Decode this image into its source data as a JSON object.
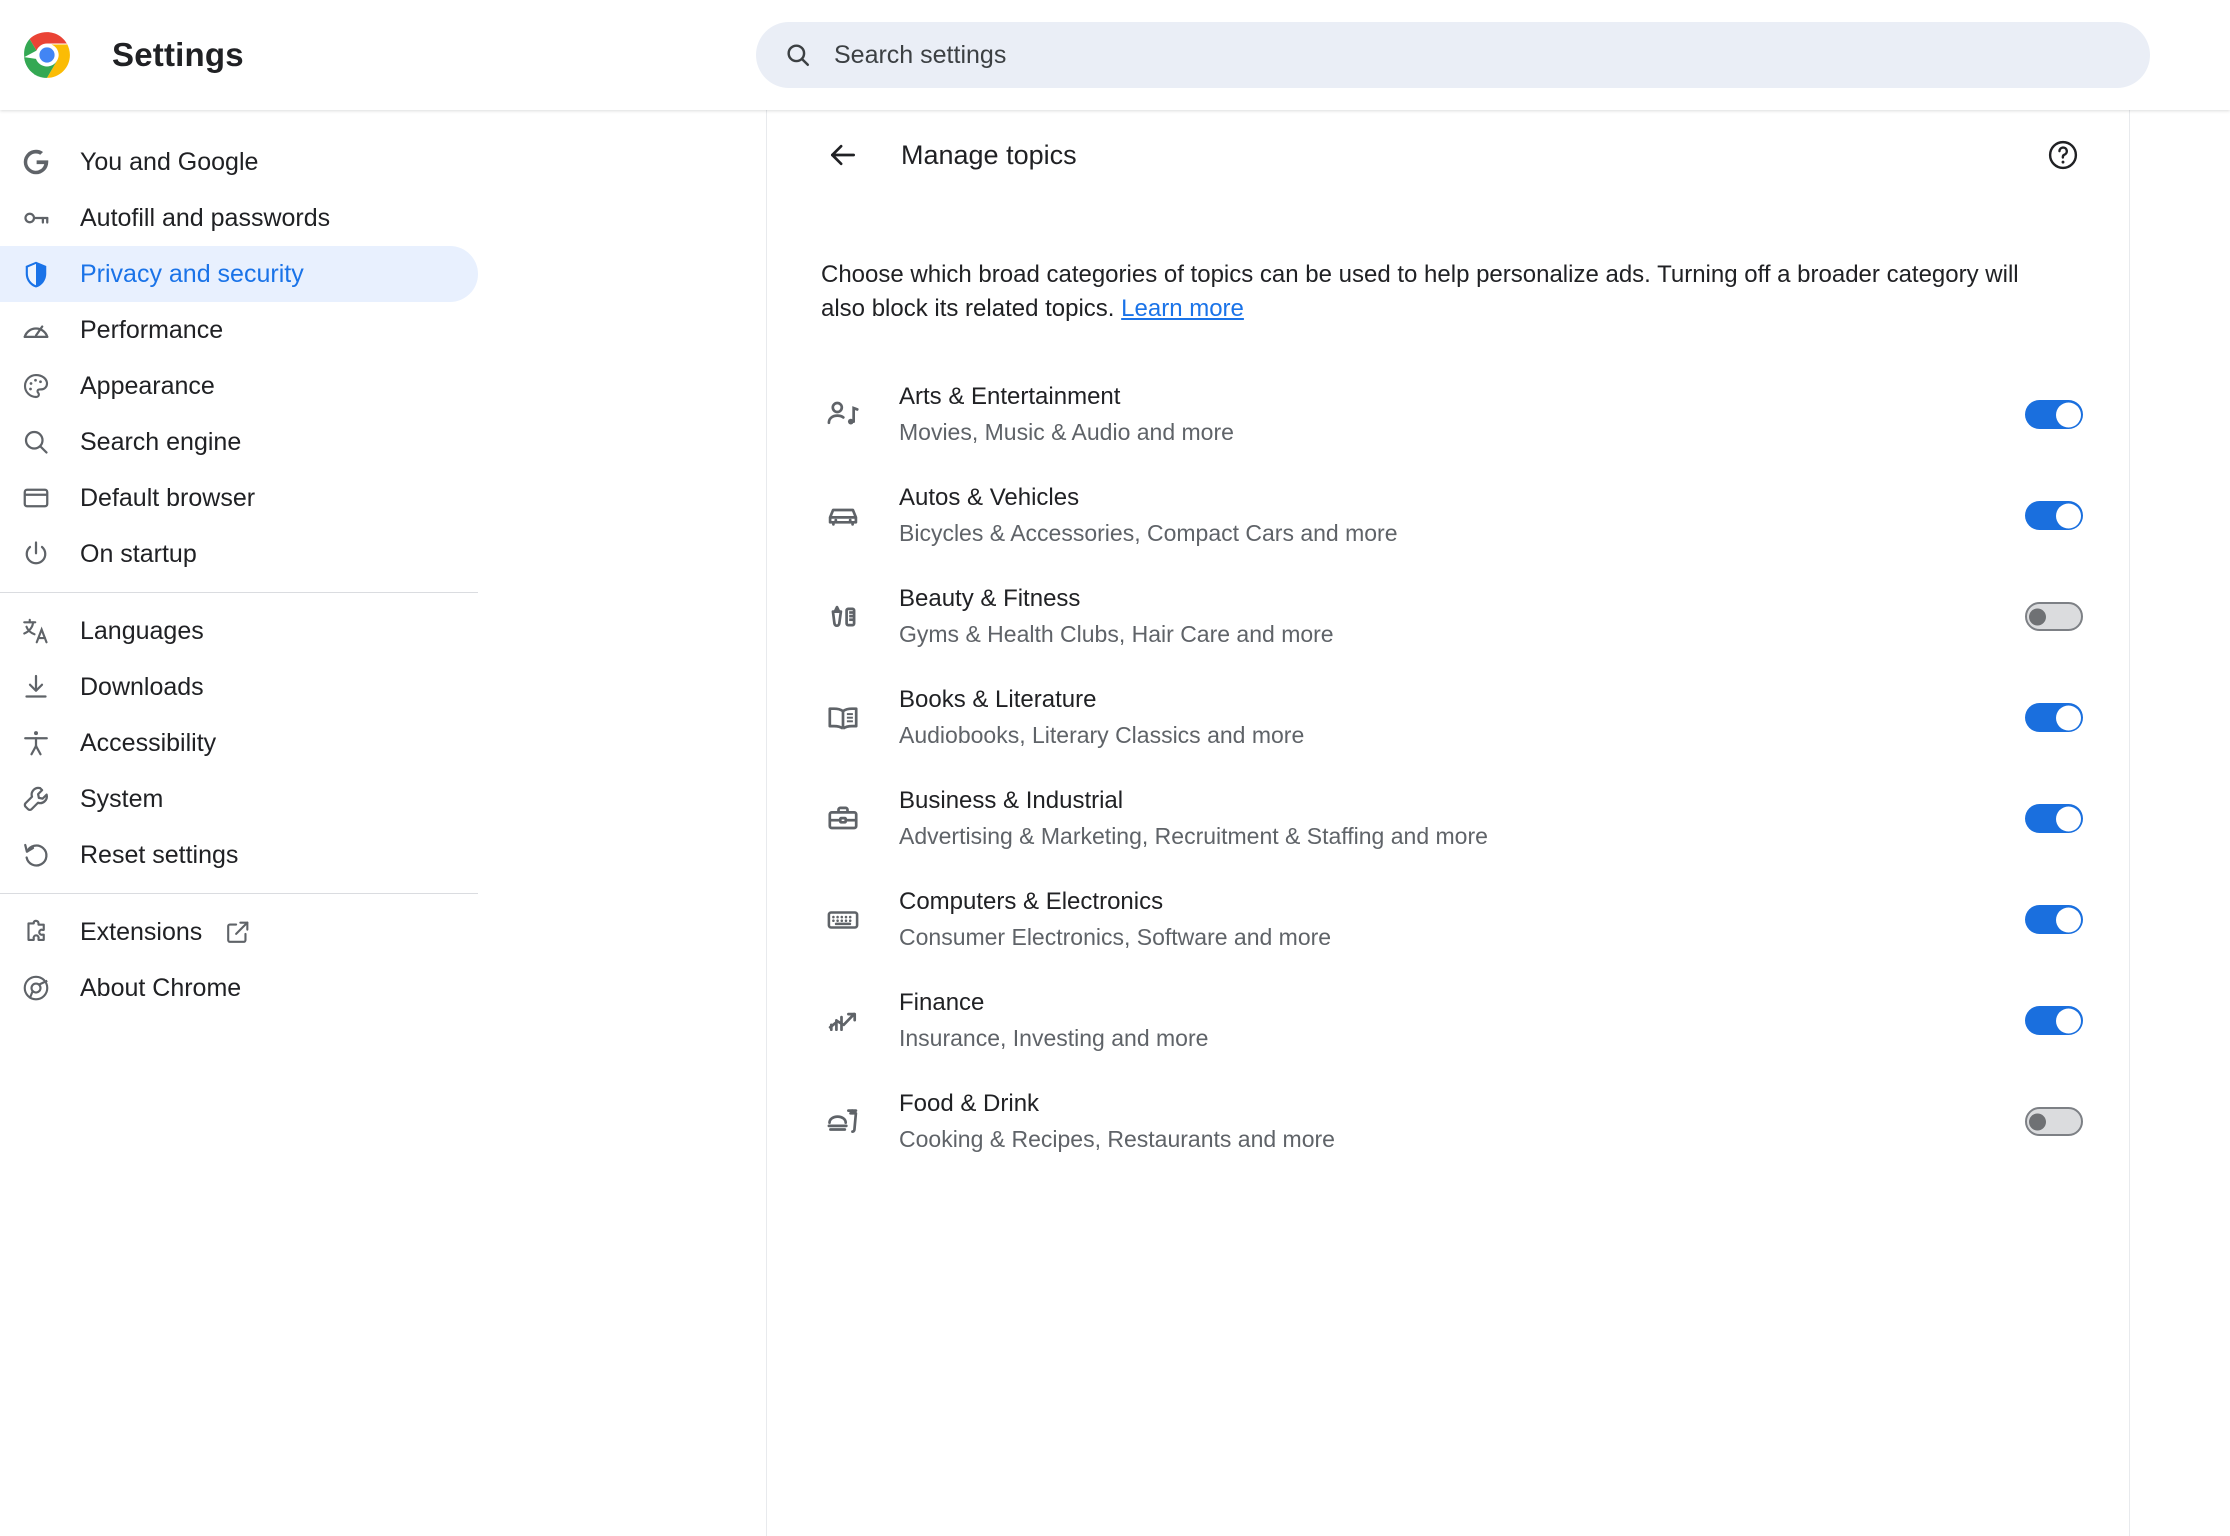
{
  "header": {
    "app_title": "Settings",
    "logo_icon": "chrome-logo-icon",
    "search": {
      "icon": "search-icon",
      "placeholder": "Search settings",
      "value": ""
    }
  },
  "sidebar": {
    "groups": [
      {
        "items": [
          {
            "label": "You and Google",
            "icon": "google-g-icon",
            "selected": false
          },
          {
            "label": "Autofill and passwords",
            "icon": "key-icon",
            "selected": false
          },
          {
            "label": "Privacy and security",
            "icon": "shield-icon",
            "selected": true
          },
          {
            "label": "Performance",
            "icon": "speedometer-icon",
            "selected": false
          },
          {
            "label": "Appearance",
            "icon": "palette-icon",
            "selected": false
          },
          {
            "label": "Search engine",
            "icon": "search-icon",
            "selected": false
          },
          {
            "label": "Default browser",
            "icon": "browser-window-icon",
            "selected": false
          },
          {
            "label": "On startup",
            "icon": "power-icon",
            "selected": false
          }
        ]
      },
      {
        "items": [
          {
            "label": "Languages",
            "icon": "translate-icon",
            "selected": false
          },
          {
            "label": "Downloads",
            "icon": "download-icon",
            "selected": false
          },
          {
            "label": "Accessibility",
            "icon": "accessibility-icon",
            "selected": false
          },
          {
            "label": "System",
            "icon": "wrench-icon",
            "selected": false
          },
          {
            "label": "Reset settings",
            "icon": "restore-icon",
            "selected": false
          }
        ]
      },
      {
        "items": [
          {
            "label": "Extensions",
            "icon": "puzzle-icon",
            "selected": false,
            "external_icon": "open-in-new-icon"
          },
          {
            "label": "About Chrome",
            "icon": "chrome-outline-icon",
            "selected": false
          }
        ]
      }
    ]
  },
  "main": {
    "back_icon": "back-arrow-icon",
    "title": "Manage topics",
    "help_icon": "help-circle-icon",
    "description": {
      "text": "Choose which broad categories of topics can be used to help personalize ads. Turning off a broader category will also block its related topics.",
      "link_label": "Learn more"
    },
    "topics": [
      {
        "title": "Arts & Entertainment",
        "subtitle": "Movies, Music & Audio and more",
        "icon": "person-music-icon",
        "enabled": true
      },
      {
        "title": "Autos & Vehicles",
        "subtitle": "Bicycles & Accessories, Compact Cars and more",
        "icon": "car-icon",
        "enabled": true
      },
      {
        "title": "Beauty & Fitness",
        "subtitle": "Gyms & Health Clubs, Hair Care and more",
        "icon": "nail-polish-comb-icon",
        "enabled": false
      },
      {
        "title": "Books & Literature",
        "subtitle": "Audiobooks, Literary Classics and more",
        "icon": "open-book-icon",
        "enabled": true
      },
      {
        "title": "Business & Industrial",
        "subtitle": "Advertising & Marketing, Recruitment & Staffing and more",
        "icon": "briefcase-icon",
        "enabled": true
      },
      {
        "title": "Computers & Electronics",
        "subtitle": "Consumer Electronics, Software and more",
        "icon": "keyboard-icon",
        "enabled": true
      },
      {
        "title": "Finance",
        "subtitle": "Insurance, Investing and more",
        "icon": "trending-chart-icon",
        "enabled": true
      },
      {
        "title": "Food & Drink",
        "subtitle": "Cooking & Recipes, Restaurants and more",
        "icon": "food-drink-icon",
        "enabled": false
      }
    ]
  },
  "colors": {
    "accent_blue": "#1a73e8",
    "toggle_on": "#1a6fde",
    "toggle_off_track": "#dbdcde",
    "selected_pill": "#e8f0fe",
    "text_primary": "#202124",
    "text_secondary": "#5f6368",
    "search_bg": "#eaeef6"
  }
}
